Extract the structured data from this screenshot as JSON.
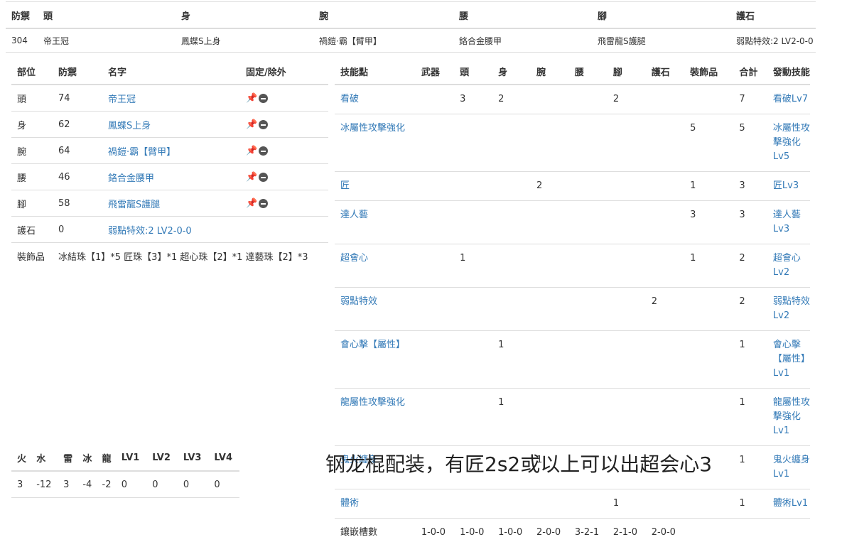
{
  "summary": {
    "headers": [
      "防禦",
      "頭",
      "身",
      "腕",
      "腰",
      "腳",
      "護石"
    ],
    "values": [
      "304",
      "帝王冠",
      "鳳蝶S上身",
      "禍鎧·霸【臂甲】",
      "鉻合金腰甲",
      "飛雷龍S護腿",
      "弱點特效:2 LV2-0-0"
    ]
  },
  "parts": {
    "headers": [
      "部位",
      "防禦",
      "名字",
      "固定/除外"
    ],
    "rows": [
      {
        "slot": "頭",
        "def": "74",
        "name": "帝王冠"
      },
      {
        "slot": "身",
        "def": "62",
        "name": "鳳蝶S上身"
      },
      {
        "slot": "腕",
        "def": "64",
        "name": "禍鎧·霸【臂甲】"
      },
      {
        "slot": "腰",
        "def": "46",
        "name": "鉻合金腰甲"
      },
      {
        "slot": "腳",
        "def": "58",
        "name": "飛雷龍S護腿"
      }
    ],
    "charm": {
      "slot": "護石",
      "def": "0",
      "name": "弱點特效:2 LV2-0-0"
    },
    "deco": {
      "label": "裝飾品",
      "value": "冰結珠【1】*5 匠珠【3】*1 超心珠【2】*1 達藝珠【2】*3"
    }
  },
  "skills": {
    "headers": [
      "技能點",
      "武器",
      "頭",
      "身",
      "腕",
      "腰",
      "腳",
      "護石",
      "裝飾品",
      "合計",
      "發動技能"
    ],
    "rows": [
      [
        "看破",
        "",
        "3",
        "2",
        "",
        "",
        "2",
        "",
        "",
        "7",
        "看破Lv7"
      ],
      [
        "冰屬性攻擊強化",
        "",
        "",
        "",
        "",
        "",
        "",
        "",
        "5",
        "5",
        "冰屬性攻擊強化Lv5"
      ],
      [
        "匠",
        "",
        "",
        "",
        "2",
        "",
        "",
        "",
        "1",
        "3",
        "匠Lv3"
      ],
      [
        "達人藝",
        "",
        "",
        "",
        "",
        "",
        "",
        "",
        "3",
        "3",
        "達人藝Lv3"
      ],
      [
        "超會心",
        "",
        "1",
        "",
        "",
        "",
        "",
        "",
        "1",
        "2",
        "超會心Lv2"
      ],
      [
        "弱點特效",
        "",
        "",
        "",
        "",
        "",
        "",
        "2",
        "",
        "2",
        "弱點特效Lv2"
      ],
      [
        "會心擊【屬性】",
        "",
        "",
        "1",
        "",
        "",
        "",
        "",
        "",
        "1",
        "會心擊【屬性】Lv1"
      ],
      [
        "龍屬性攻擊強化",
        "",
        "",
        "1",
        "",
        "",
        "",
        "",
        "",
        "1",
        "龍屬性攻擊強化Lv1"
      ],
      [
        "鬼火纏身",
        "",
        "",
        "",
        "1",
        "",
        "",
        "",
        "",
        "1",
        "鬼火纏身Lv1"
      ],
      [
        "體術",
        "",
        "",
        "",
        "",
        "",
        "1",
        "",
        "",
        "1",
        "體術Lv1"
      ]
    ],
    "slots": [
      "鑲嵌槽數",
      "1-0-0",
      "1-0-0",
      "1-0-0",
      "2-0-0",
      "3-2-1",
      "2-1-0",
      "2-0-0",
      "",
      "",
      ""
    ]
  },
  "resist": {
    "headers": [
      "火",
      "水",
      "雷",
      "冰",
      "龍",
      "LV1",
      "LV2",
      "LV3",
      "LV4"
    ],
    "values": [
      "3",
      "-12",
      "3",
      "-4",
      "-2",
      "0",
      "0",
      "0",
      "0"
    ]
  },
  "note": "钢龙棍配装，有匠2s2或以上可以出超会心3",
  "colors": {
    "link": "#337ab7",
    "border": "#dddddd",
    "text": "#333333"
  }
}
